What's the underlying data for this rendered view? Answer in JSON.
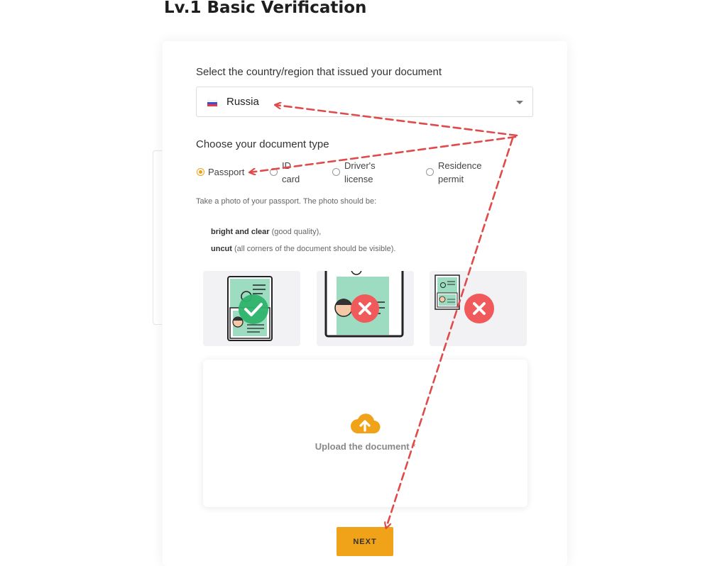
{
  "page": {
    "title": "Lv.1 Basic Verification"
  },
  "country": {
    "label": "Select the country/region that issued your document",
    "selected": "Russia"
  },
  "document_type": {
    "label": "Choose your document type",
    "options": [
      {
        "line1": "Passport",
        "line2": "",
        "selected": true
      },
      {
        "line1": "ID",
        "line2": "card",
        "selected": false
      },
      {
        "line1": "Driver's",
        "line2": "license",
        "selected": false
      },
      {
        "line1": "Residence",
        "line2": "permit",
        "selected": false
      }
    ]
  },
  "instructions": {
    "intro": "Take a photo of your passport. The photo should be:",
    "req1_bold": "bright and clear",
    "req1_rest": " (good quality),",
    "req2_bold": "uncut",
    "req2_rest": " (all corners of the document should be visible)."
  },
  "samples": [
    {
      "status": "correct",
      "icon": "check-icon"
    },
    {
      "status": "incorrect",
      "icon": "cross-icon"
    },
    {
      "status": "incorrect",
      "icon": "cross-icon"
    }
  ],
  "upload": {
    "label": "Upload the document",
    "required_mark": "*"
  },
  "next_button": "NEXT",
  "colors": {
    "accent": "#f0a218",
    "annotation": "#e04a4a",
    "document_green": "#9ddcc0",
    "ok_green": "#2fb36b",
    "error_red": "#f05a5a"
  }
}
